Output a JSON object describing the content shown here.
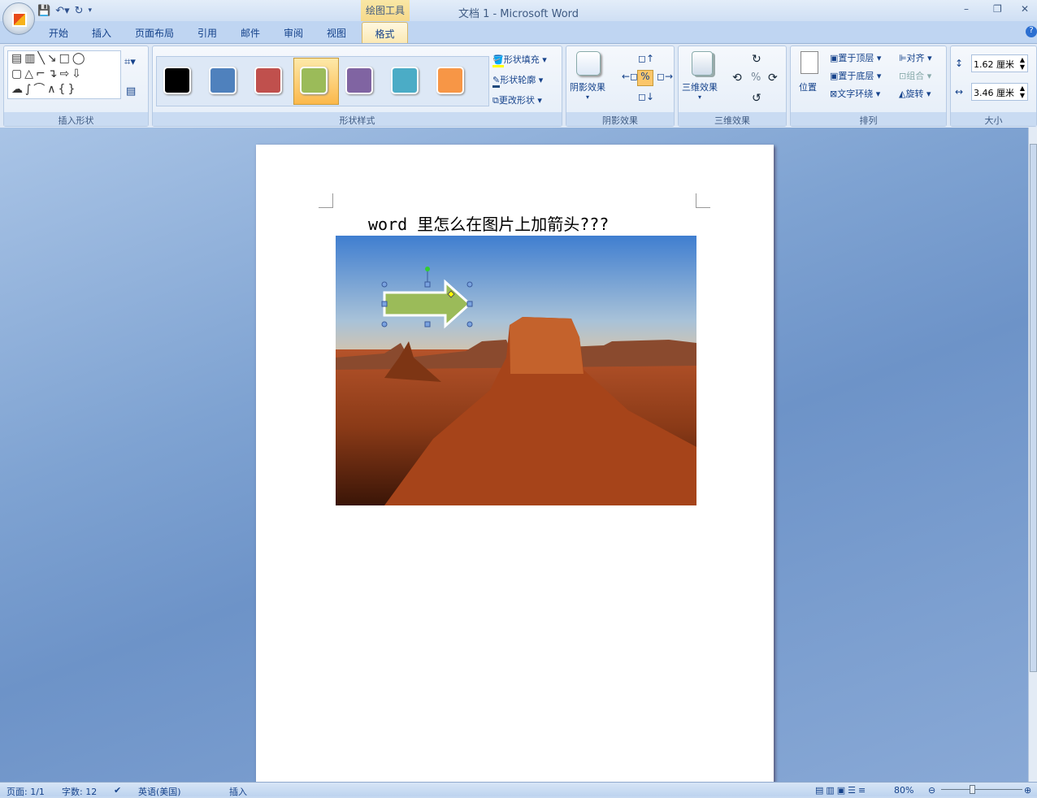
{
  "window": {
    "title": "文档 1 - Microsoft Word",
    "contextual_tab": "绘图工具"
  },
  "tabs": [
    "开始",
    "插入",
    "页面布局",
    "引用",
    "邮件",
    "审阅",
    "视图",
    "格式"
  ],
  "ribbon": {
    "insert_shapes": {
      "label": "插入形状"
    },
    "shape_styles": {
      "label": "形状样式",
      "swatches": [
        "#000000",
        "#4f81bd",
        "#c0504d",
        "#9bbb59",
        "#8064a2",
        "#4bacc6",
        "#f79646"
      ],
      "selected_index": 3,
      "fill": "形状填充",
      "outline": "形状轮廓",
      "change": "更改形状"
    },
    "shadow": {
      "label": "阴影效果",
      "button": "阴影效果"
    },
    "threed": {
      "label": "三维效果",
      "button": "三维效果"
    },
    "arrange": {
      "label": "排列",
      "position": "位置",
      "front": "置于顶层",
      "back": "置于底层",
      "wrap": "文字环绕",
      "align": "对齐",
      "group": "组合",
      "rotate": "旋转"
    },
    "size": {
      "label": "大小",
      "height": "1.62 厘米",
      "width": "3.46 厘米"
    }
  },
  "document": {
    "heading": "word 里怎么在图片上加箭头???"
  },
  "status": {
    "page": "页面: 1/1",
    "words": "字数: 12",
    "language": "英语(美国)",
    "mode": "插入",
    "zoom": "80%"
  }
}
